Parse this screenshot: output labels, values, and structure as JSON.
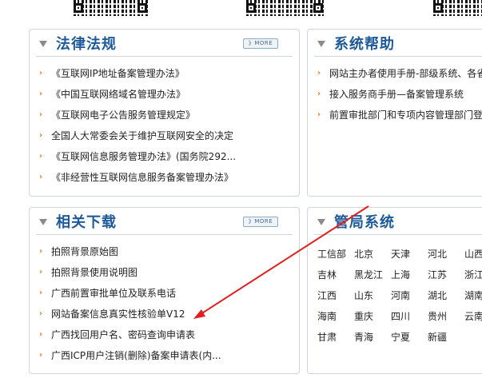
{
  "panels": {
    "laws": {
      "title": "法律法规",
      "more": "》MORE",
      "items": [
        "《互联网IP地址备案管理办法》",
        "《中国互联网络域名管理办法》",
        "《互联网电子公告服务管理规定》",
        "全国人大常委会关于维护互联网安全的决定",
        "《互联网信息服务管理办法》(国务院292...",
        "《非经营性互联网信息服务备案管理办法》"
      ]
    },
    "help": {
      "title": "系统帮助",
      "items": [
        "网站主办者使用手册-部级系统、各省",
        "接入服务商手册—备案管理系统",
        "前置审批部门和专项内容管理部门登"
      ]
    },
    "downloads": {
      "title": "相关下载",
      "more": "》MORE",
      "items": [
        "拍照背景原始图",
        "拍照背景使用说明图",
        "广西前置审批单位及联系电话",
        "网站备案信息真实性核验单V12",
        "广西找回用户名、密码查询申请表",
        "广西ICP用户注销(删除)备案申请表(内..."
      ]
    },
    "regions": {
      "title": "管局系统",
      "rows": [
        [
          "工信部",
          "北京",
          "天津",
          "河北",
          "山西"
        ],
        [
          "吉林",
          "黑龙江",
          "上海",
          "江苏",
          "浙江"
        ],
        [
          "江西",
          "山东",
          "河南",
          "湖北",
          "湖南"
        ],
        [
          "海南",
          "重庆",
          "四川",
          "贵州",
          "云南"
        ],
        [
          "甘肃",
          "青海",
          "宁夏",
          "新疆"
        ]
      ]
    }
  },
  "colors": {
    "title": "#1e5a99",
    "bullet": "#e07a1a",
    "arrow": "#e02020",
    "border": "#cfd6de"
  }
}
